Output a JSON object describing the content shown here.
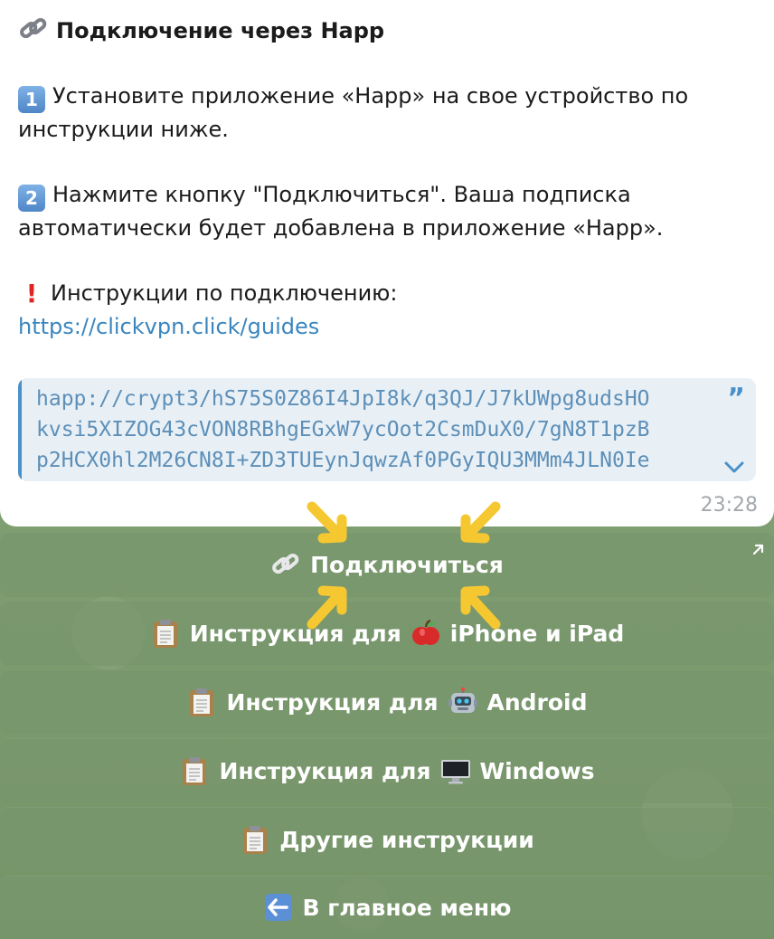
{
  "message": {
    "title": "Подключение через Happ",
    "step1_line1": "Установите приложение «Happ» на свое устройство по",
    "step1_line2": "инструкции ниже.",
    "step1_num": "1",
    "step2_line1": "Нажмите кнопку \"Подключиться\". Ваша подписка",
    "step2_line2": "автоматически будет добавлена в приложение «Happ».",
    "step2_num": "2",
    "guides_label": "Инструкции по подключению:",
    "guides_link": "https://clickvpn.click/guides",
    "quote_lines": [
      "happ://crypt3/hS75S0Z86I4JpI8k/q3QJ/J7kUWpg8udsHO",
      "kvsi5XIZOG43cVON8RBhgEGxW7ycOot2CsmDuX0/7gN8T1pzB",
      "p2HCX0hl2M26CN8I+ZD3TUEynJqwzAf0PGyIQU3MMm4JLN0Ie"
    ],
    "time": "23:28"
  },
  "keyboard": {
    "connect": "Подключиться",
    "ios_prefix": "Инструкция для",
    "ios_suffix": "iPhone и iPad",
    "android_prefix": "Инструкция для",
    "android_suffix": "Android",
    "windows_prefix": "Инструкция для",
    "windows_suffix": "Windows",
    "other": "Другие инструкции",
    "main_menu": "В главное меню"
  },
  "colors": {
    "link": "#3a86bf",
    "quote_bar": "#4a90c9",
    "arrow": "#f5c832"
  },
  "icons": [
    "link-icon",
    "keycap-1-icon",
    "keycap-2-icon",
    "exclamation-icon",
    "quote-icon",
    "chevron-down-icon",
    "clipboard-icon",
    "apple-icon",
    "robot-icon",
    "monitor-icon",
    "left-arrow-icon",
    "open-corner-arrow-icon",
    "yellow-arrow-icon"
  ]
}
